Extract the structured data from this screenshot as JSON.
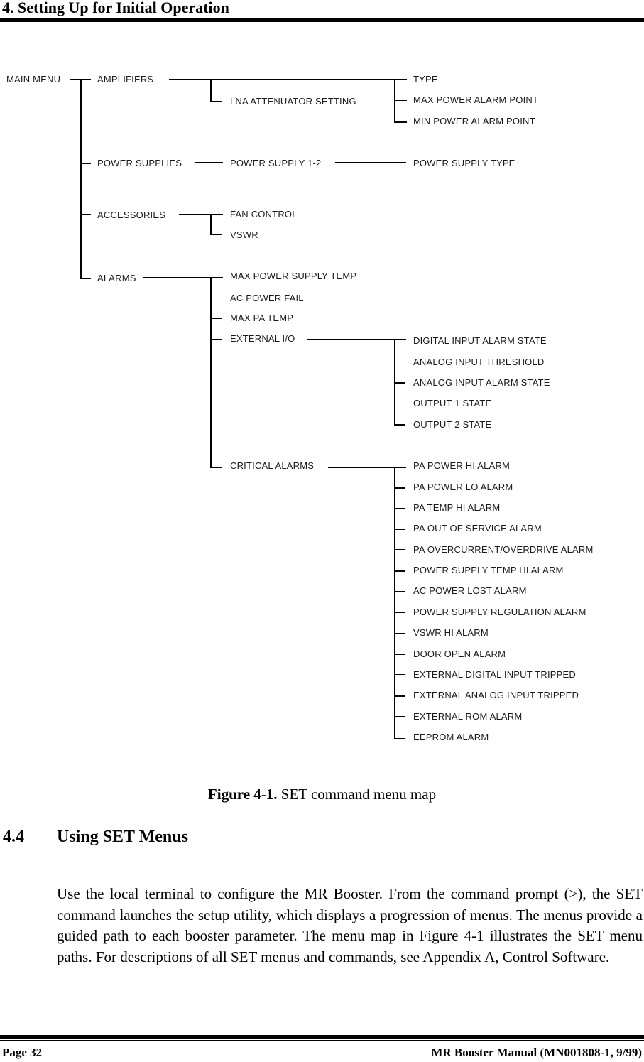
{
  "header": {
    "title": "4. Setting Up for Initial Operation"
  },
  "menu_map": {
    "root": "MAIN MENU",
    "level1": {
      "amplifiers": "AMPLIFIERS",
      "power_supplies": "POWER SUPPLIES",
      "accessories": "ACCESSORIES",
      "alarms": "ALARMS"
    },
    "amplifiers": {
      "lna_attenuator": "LNA ATTENUATOR SETTING",
      "children": [
        "TYPE",
        "MAX POWER ALARM POINT",
        "MIN POWER ALARM POINT"
      ]
    },
    "power_supplies": {
      "power_supply": "POWER SUPPLY 1-2",
      "children": [
        "POWER SUPPLY TYPE"
      ]
    },
    "accessories": {
      "children": [
        "FAN CONTROL",
        "VSWR"
      ]
    },
    "alarms": {
      "children": [
        "MAX POWER SUPPLY TEMP",
        "AC POWER FAIL",
        "MAX PA TEMP",
        "EXTERNAL I/O",
        "CRITICAL ALARMS"
      ],
      "external_io": [
        "DIGITAL INPUT ALARM STATE",
        "ANALOG INPUT THRESHOLD",
        "ANALOG INPUT ALARM STATE",
        "OUTPUT 1 STATE",
        "OUTPUT 2 STATE"
      ],
      "critical_alarms": [
        "PA POWER HI ALARM",
        "PA POWER LO ALARM",
        "PA TEMP HI ALARM",
        "PA OUT OF SERVICE ALARM",
        "PA OVERCURRENT/OVERDRIVE ALARM",
        "POWER SUPPLY TEMP HI ALARM",
        "AC POWER LOST ALARM",
        "POWER SUPPLY REGULATION ALARM",
        "VSWR HI ALARM",
        "DOOR OPEN ALARM",
        "EXTERNAL DIGITAL INPUT TRIPPED",
        "EXTERNAL ANALOG INPUT TRIPPED",
        "EXTERNAL ROM ALARM",
        "EEPROM ALARM"
      ]
    }
  },
  "figure": {
    "label": "Figure 4-1.",
    "caption": " SET command menu map"
  },
  "section": {
    "number": "4.4",
    "title": "Using SET Menus",
    "paragraph": "Use the local terminal to configure the MR Booster. From the command prompt (>), the SET command launches the setup utility, which displays a progression of menus. The menus provide a guided path to each booster parameter.  The menu map in Figure 4-1 illustrates the SET menu paths.  For descriptions of all SET menus and commands, see Appendix A, Control Software."
  },
  "footer": {
    "page": "Page 32",
    "manual": "MR Booster Manual (MN001808-1, 9/99)"
  }
}
